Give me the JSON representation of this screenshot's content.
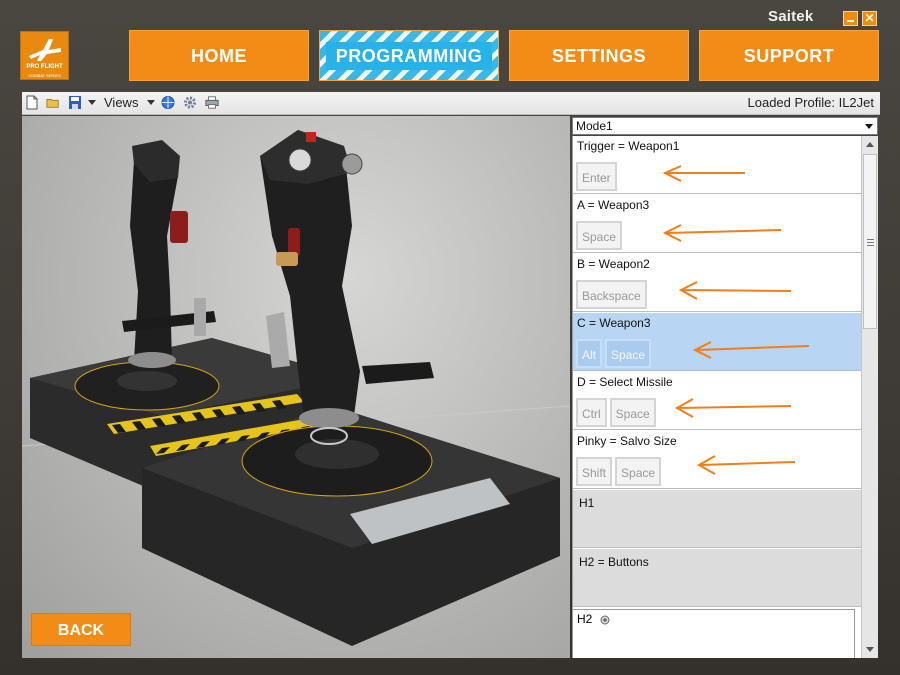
{
  "app": {
    "brand": "Saitek",
    "logo_line1": "PRO FLIGHT",
    "logo_line2": "COMBAT SERIES"
  },
  "nav": {
    "home": "HOME",
    "programming": "PROGRAMMING",
    "settings": "SETTINGS",
    "support": "SUPPORT",
    "active": "PROGRAMMING"
  },
  "toolbar": {
    "views_label": "Views",
    "loaded_profile": "Loaded Profile: IL2Jet"
  },
  "mode": {
    "selected": "Mode1"
  },
  "bindings": [
    {
      "title": "Trigger = Weapon1",
      "keys": [
        "Enter"
      ],
      "selected": false
    },
    {
      "title": "A = Weapon3",
      "keys": [
        "Space"
      ],
      "selected": false
    },
    {
      "title": "B = Weapon2",
      "keys": [
        "Backspace"
      ],
      "selected": false
    },
    {
      "title": "C = Weapon3",
      "keys": [
        "Alt",
        "Space"
      ],
      "selected": true
    },
    {
      "title": "D = Select Missile",
      "keys": [
        "Ctrl",
        "Space"
      ],
      "selected": false
    },
    {
      "title": "Pinky = Salvo Size",
      "keys": [
        "Shift",
        "Space"
      ],
      "selected": false
    },
    {
      "title": "H1",
      "keys": [],
      "selected": false
    },
    {
      "title": "H2 = Buttons",
      "keys": [],
      "selected": false
    }
  ],
  "h2_bottom": {
    "title": "H2"
  },
  "back_button": "BACK",
  "colors": {
    "accent_orange": "#f28c16",
    "active_blue": "#27b3e8",
    "selected_row": "#b8d6f4",
    "annotation": "#f07f1a"
  }
}
